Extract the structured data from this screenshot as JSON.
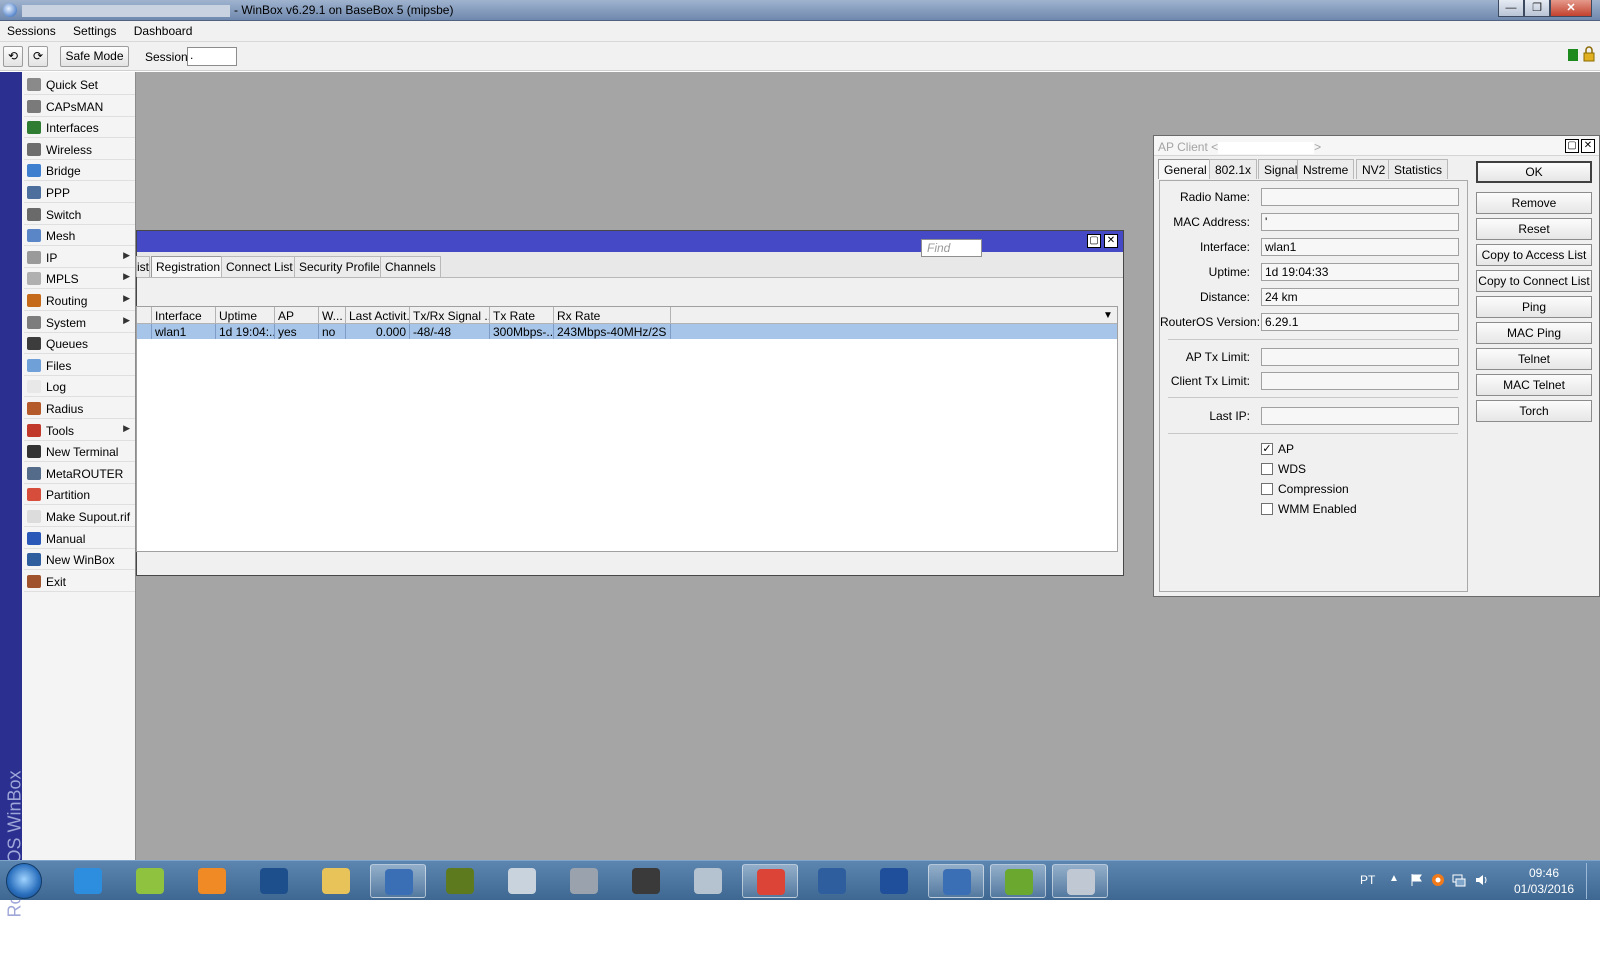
{
  "window": {
    "title_suffix": "- WinBox v6.29.1 on BaseBox 5 (mipsbe)",
    "controls": {
      "minimize": "—",
      "maximize": "❐",
      "close": "✕"
    }
  },
  "menu": [
    "Sessions",
    "Settings",
    "Dashboard"
  ],
  "toolbar": {
    "undo": "⟲",
    "redo": "⟳",
    "safe_mode": "Safe Mode",
    "session_label": "Session:",
    "session_value": "."
  },
  "sidebar": {
    "brand": "RouterOS WinBox",
    "items": [
      {
        "label": "Quick Set",
        "icon": "quick-set-icon",
        "color": "#8a8a8a"
      },
      {
        "label": "CAPsMAN",
        "icon": "capsman-icon",
        "color": "#7a7a7a"
      },
      {
        "label": "Interfaces",
        "icon": "interfaces-icon",
        "color": "#2e7d32"
      },
      {
        "label": "Wireless",
        "icon": "wireless-icon",
        "color": "#6d6d6d"
      },
      {
        "label": "Bridge",
        "icon": "bridge-icon",
        "color": "#3f7fd0"
      },
      {
        "label": "PPP",
        "icon": "ppp-icon",
        "color": "#4d6f9e"
      },
      {
        "label": "Switch",
        "icon": "switch-icon",
        "color": "#6a6a6a"
      },
      {
        "label": "Mesh",
        "icon": "mesh-icon",
        "color": "#5a86c8"
      },
      {
        "label": "IP",
        "icon": "ip-icon",
        "color": "#9a9a9a",
        "arrow": "▶"
      },
      {
        "label": "MPLS",
        "icon": "mpls-icon",
        "color": "#b0b0b0",
        "arrow": "▶"
      },
      {
        "label": "Routing",
        "icon": "routing-icon",
        "color": "#c46a1a",
        "arrow": "▶"
      },
      {
        "label": "System",
        "icon": "system-gear-icon",
        "color": "#7d7d7d",
        "arrow": "▶"
      },
      {
        "label": "Queues",
        "icon": "queues-icon",
        "color": "#3c3c3c"
      },
      {
        "label": "Files",
        "icon": "files-folder-icon",
        "color": "#6fa0d8"
      },
      {
        "label": "Log",
        "icon": "log-icon",
        "color": "#e8e8e8"
      },
      {
        "label": "Radius",
        "icon": "radius-users-icon",
        "color": "#b55a2a"
      },
      {
        "label": "Tools",
        "icon": "tools-icon",
        "color": "#c0392b",
        "arrow": "▶"
      },
      {
        "label": "New Terminal",
        "icon": "terminal-icon",
        "color": "#333333"
      },
      {
        "label": "MetaROUTER",
        "icon": "metarouter-icon",
        "color": "#556b8a"
      },
      {
        "label": "Partition",
        "icon": "partition-pie-icon",
        "color": "#d64d3b"
      },
      {
        "label": "Make Supout.rif",
        "icon": "supout-doc-icon",
        "color": "#dcdcdc"
      },
      {
        "label": "Manual",
        "icon": "manual-help-icon",
        "color": "#2a58b8"
      },
      {
        "label": "New WinBox",
        "icon": "winbox-globe-icon",
        "color": "#2f5e9e"
      },
      {
        "label": "Exit",
        "icon": "exit-door-icon",
        "color": "#a0522d"
      }
    ]
  },
  "wireless_window": {
    "tabs": [
      "ist",
      "Registration",
      "Connect List",
      "Security Profiles",
      "Channels"
    ],
    "active_tab": "Registration",
    "find_placeholder": "Find",
    "columns": [
      "Interface",
      "Uptime",
      "AP",
      "W...",
      "Last Activit...",
      "Tx/Rx Signal ...",
      "Tx Rate",
      "Rx Rate"
    ],
    "rows": [
      [
        "wlan1",
        "1d 19:04:...",
        "yes",
        "no",
        "0.000",
        "-48/-48",
        "300Mbps-...",
        "243Mbps-40MHz/2S"
      ]
    ],
    "dropdown": "▼"
  },
  "ap_client": {
    "title_prefix": "AP Client <",
    "title_suffix": ">",
    "tabs": [
      "General",
      "802.1x",
      "Signal",
      "Nstreme",
      "NV2",
      "Statistics"
    ],
    "active_tab": "General",
    "fields": [
      {
        "label": "Radio Name:",
        "value": ""
      },
      {
        "label": "MAC Address:",
        "value": "'"
      },
      {
        "label": "Interface:",
        "value": "wlan1"
      },
      {
        "label": "Uptime:",
        "value": "1d 19:04:33"
      },
      {
        "label": "Distance:",
        "value": "24 km"
      },
      {
        "label": "RouterOS Version:",
        "value": "6.29.1"
      }
    ],
    "limits": [
      {
        "label": "AP Tx Limit:",
        "value": ""
      },
      {
        "label": "Client Tx Limit:",
        "value": ""
      }
    ],
    "last_ip": {
      "label": "Last IP:",
      "value": ""
    },
    "checkboxes": [
      {
        "label": "AP",
        "checked": true
      },
      {
        "label": "WDS",
        "checked": false
      },
      {
        "label": "Compression",
        "checked": false
      },
      {
        "label": "WMM Enabled",
        "checked": false
      }
    ],
    "buttons": [
      "OK",
      "Remove",
      "Reset",
      "Copy to Access List",
      "Copy to Connect List",
      "Ping",
      "MAC Ping",
      "Telnet",
      "MAC Telnet",
      "Torch"
    ],
    "checkmark": "✓"
  },
  "taskbar": {
    "apps": [
      {
        "name": "internet-explorer-icon",
        "color": "#2d8ee0",
        "open": false
      },
      {
        "name": "notepadpp-icon",
        "color": "#8fc23f",
        "open": false
      },
      {
        "name": "media-player-icon",
        "color": "#f08a24",
        "open": false
      },
      {
        "name": "photoshop-icon",
        "color": "#1d4f8c",
        "open": false
      },
      {
        "name": "file-explorer-icon",
        "color": "#e8c35a",
        "open": false
      },
      {
        "name": "winbox-taskbar-icon",
        "color": "#3b6fb5",
        "open": true
      },
      {
        "name": "dreamweaver-icon",
        "color": "#5d7a1f",
        "open": false
      },
      {
        "name": "calculator-icon",
        "color": "#c9d3de",
        "open": false
      },
      {
        "name": "usb-stick-icon",
        "color": "#9aa3ad",
        "open": false
      },
      {
        "name": "pen-tool-icon",
        "color": "#3a3a3a",
        "open": false
      },
      {
        "name": "network-computer-icon",
        "color": "#b5c2cf",
        "open": false
      },
      {
        "name": "chrome-icon",
        "color": "#db4437",
        "open": true
      },
      {
        "name": "network-tool-icon",
        "color": "#2e5e9e",
        "open": false
      },
      {
        "name": "usb-util-icon",
        "color": "#1f4f9a",
        "open": false
      },
      {
        "name": "winbox-taskbar-2-icon",
        "color": "#3b6fb5",
        "open": true
      },
      {
        "name": "utorrent-icon",
        "color": "#6aa82f",
        "open": true
      },
      {
        "name": "sketch-app-icon",
        "color": "#c0c8d4",
        "open": true
      }
    ],
    "lang": "PT",
    "tray_up": "▲",
    "time": "09:46",
    "date": "01/03/2016"
  }
}
